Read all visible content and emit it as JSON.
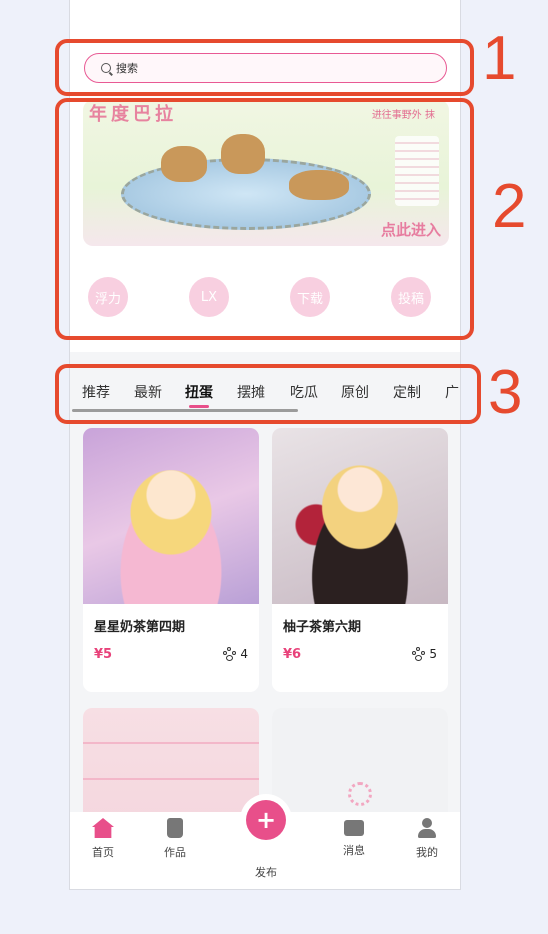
{
  "search": {
    "placeholder": "搜索"
  },
  "banner": {
    "title": "年度巴拉",
    "subtitle": "进往事野外 抹",
    "cta": "点此进入"
  },
  "categories": [
    "浮力",
    "LX",
    "下载",
    "投稿"
  ],
  "tabs": {
    "items": [
      "推荐",
      "最新",
      "扭蛋",
      "摆摊",
      "吃瓜",
      "原创",
      "定制",
      "广"
    ],
    "active_index": 2
  },
  "products": [
    {
      "title": "星星奶茶第四期",
      "price": "¥5",
      "likes": "4"
    },
    {
      "title": "柚子茶第六期",
      "price": "¥6",
      "likes": "5"
    }
  ],
  "bottom_nav": {
    "home": "首页",
    "works": "作品",
    "publish": "发布",
    "messages": "消息",
    "mine": "我的"
  },
  "annotations": [
    "1",
    "2",
    "3"
  ],
  "colors": {
    "accent": "#e84f8a",
    "annotation": "#e64a2e"
  }
}
